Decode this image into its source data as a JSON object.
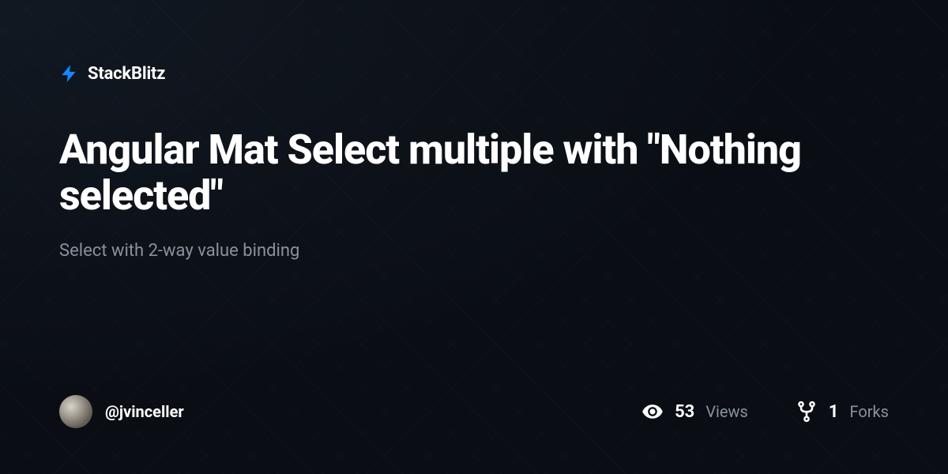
{
  "brand": {
    "name": "StackBlitz",
    "accent_color": "#1389fd"
  },
  "project": {
    "title": "Angular Mat Select multiple with \"Nothing selected\"",
    "subtitle": "Select with 2-way value binding"
  },
  "author": {
    "username": "@jvinceller"
  },
  "stats": {
    "views": {
      "count": "53",
      "label": "Views"
    },
    "forks": {
      "count": "1",
      "label": "Forks"
    }
  }
}
